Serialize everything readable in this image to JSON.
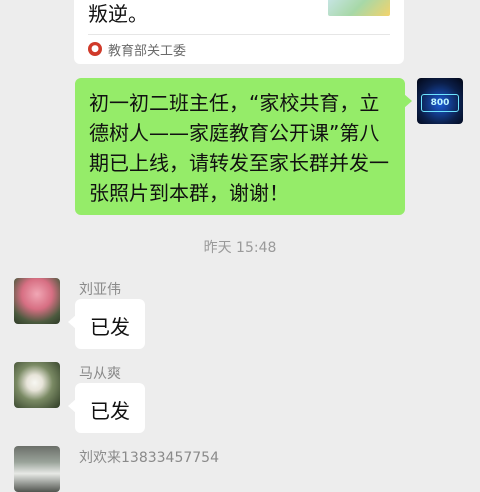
{
  "shared_card": {
    "snippet": "叛逆。",
    "source": "教育部关工委",
    "source_icon": "official-account-icon"
  },
  "self_message": {
    "text": "初一初二班主任，“家校共育，立德树人——家庭教育公开课”第八期已上线，请转发至家长群并发一张照片到本群，谢谢！",
    "avatar_text": "800"
  },
  "timestamp": "昨天 15:48",
  "messages": [
    {
      "sender": "刘亚伟",
      "text": "已发"
    },
    {
      "sender": "马从爽",
      "text": "已发"
    },
    {
      "sender": "刘欢来13833457754",
      "text": ""
    }
  ],
  "colors": {
    "background": "#ededed",
    "self_bubble": "#95ec69",
    "other_bubble": "#ffffff",
    "meta_text": "#9a9a9a"
  }
}
